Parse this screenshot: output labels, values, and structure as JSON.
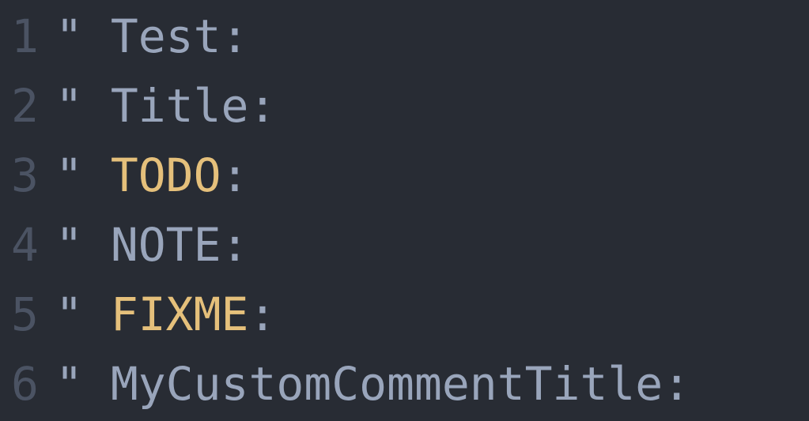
{
  "lines": [
    {
      "num": "1",
      "quote": "\"",
      "pre_space": " ",
      "keyword": "",
      "keyword_highlight": false,
      "rest": "Test:"
    },
    {
      "num": "2",
      "quote": "\"",
      "pre_space": " ",
      "keyword": "",
      "keyword_highlight": false,
      "rest": "Title:"
    },
    {
      "num": "3",
      "quote": "\"",
      "pre_space": " ",
      "keyword": "TODO",
      "keyword_highlight": true,
      "rest": ":"
    },
    {
      "num": "4",
      "quote": "\"",
      "pre_space": " ",
      "keyword": "",
      "keyword_highlight": false,
      "rest": "NOTE:"
    },
    {
      "num": "5",
      "quote": "\"",
      "pre_space": " ",
      "keyword": "FIXME",
      "keyword_highlight": true,
      "rest": ":"
    },
    {
      "num": "6",
      "quote": "\"",
      "pre_space": " ",
      "keyword": "",
      "keyword_highlight": false,
      "rest": "MyCustomCommentTitle:"
    }
  ]
}
